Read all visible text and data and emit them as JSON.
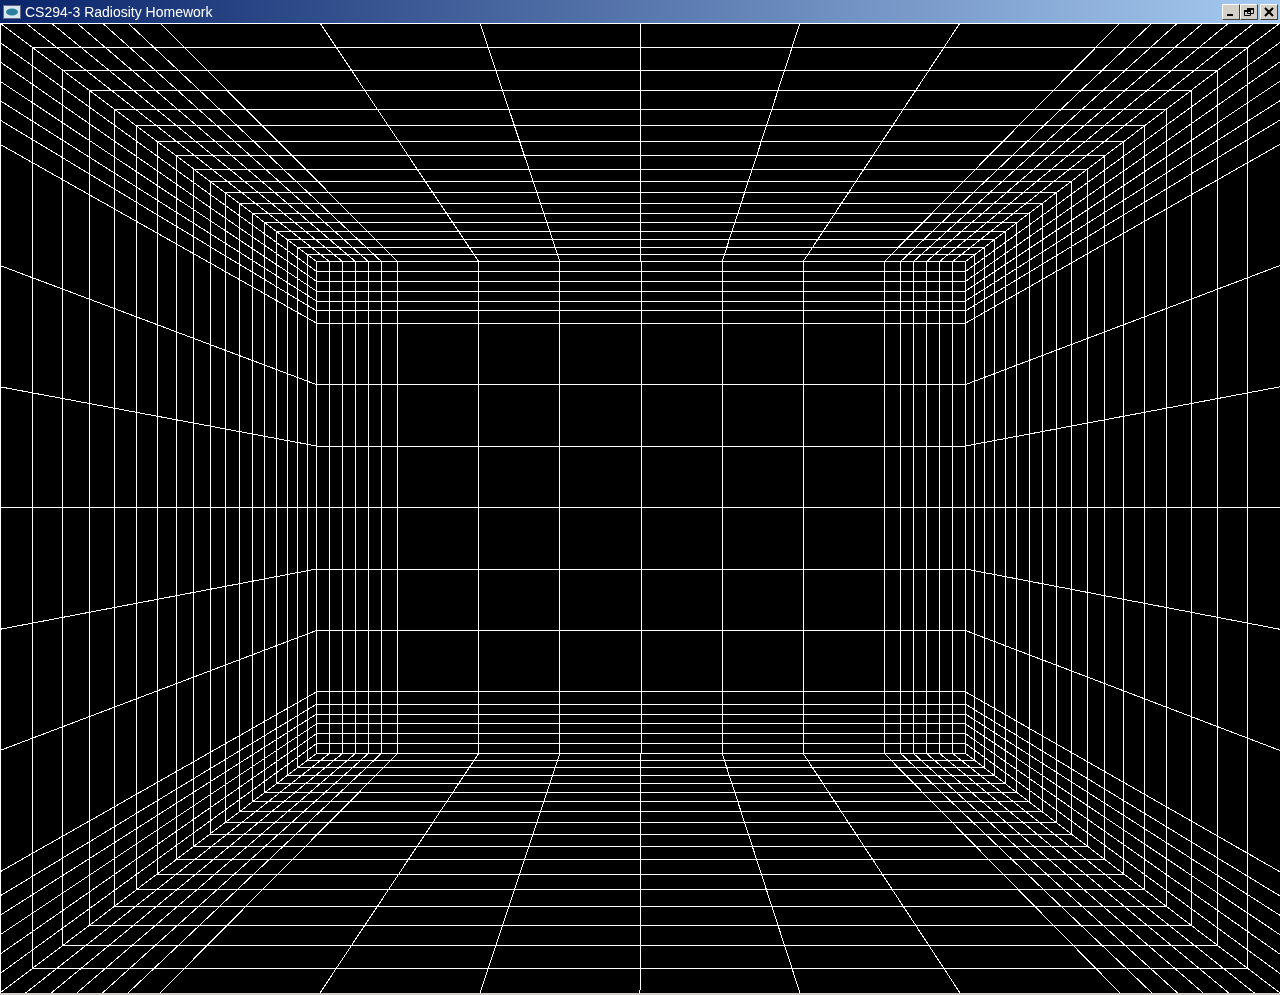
{
  "window": {
    "title": "CS294-3 Radiosity Homework"
  }
}
